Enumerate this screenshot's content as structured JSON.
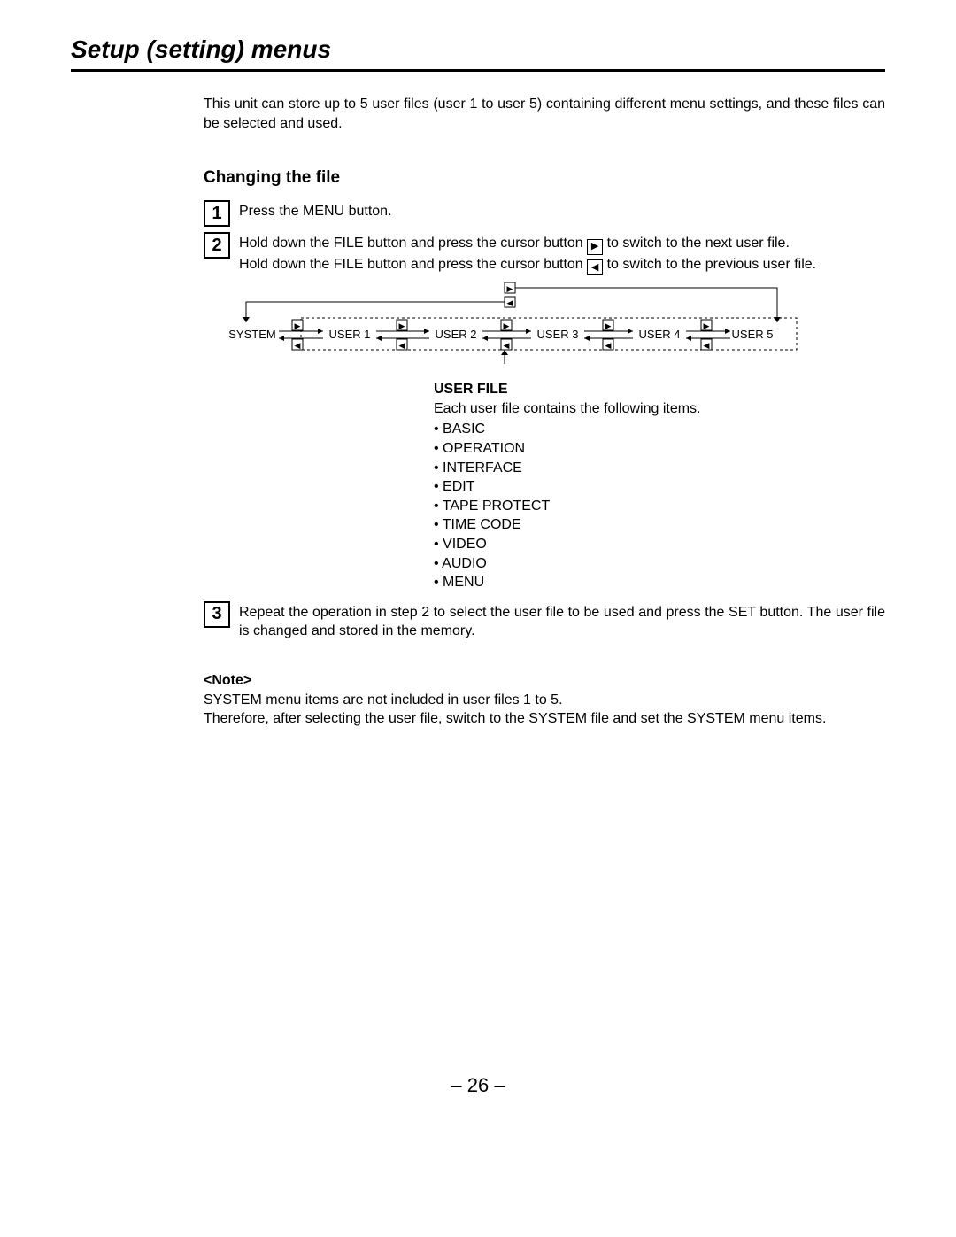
{
  "title": "Setup (setting) menus",
  "intro": "This unit can store up to 5 user files (user 1 to user 5) containing different menu settings, and these files can be selected and used.",
  "sub_heading": "Changing the file",
  "step1": {
    "num": "1",
    "text": "Press the MENU button."
  },
  "step2": {
    "num": "2",
    "line1_pre": "Hold down the FILE button and press the cursor button ",
    "line1_post": " to switch to the next user file.",
    "line2_pre": "Hold down the FILE button and press the cursor button ",
    "line2_post": " to switch to the previous user file."
  },
  "diagram": {
    "nodes": [
      "SYSTEM",
      "USER 1",
      "USER 2",
      "USER 3",
      "USER 4",
      "USER 5"
    ]
  },
  "user_file": {
    "title": "USER FILE",
    "desc": "Each user file contains the following items.",
    "items": [
      "BASIC",
      "OPERATION",
      "INTERFACE",
      "EDIT",
      "TAPE PROTECT",
      "TIME CODE",
      "VIDEO",
      "AUDIO",
      "MENU"
    ]
  },
  "step3": {
    "num": "3",
    "text": "Repeat the operation in step 2 to select the user file to be used and press the SET button. The user file is changed and stored in the memory."
  },
  "note": {
    "label": "<Note>",
    "line1": "SYSTEM menu items are not included in user files 1 to 5.",
    "line2": "Therefore, after selecting the user file, switch to the SYSTEM file and set the SYSTEM menu items."
  },
  "page_num": "– 26 –"
}
